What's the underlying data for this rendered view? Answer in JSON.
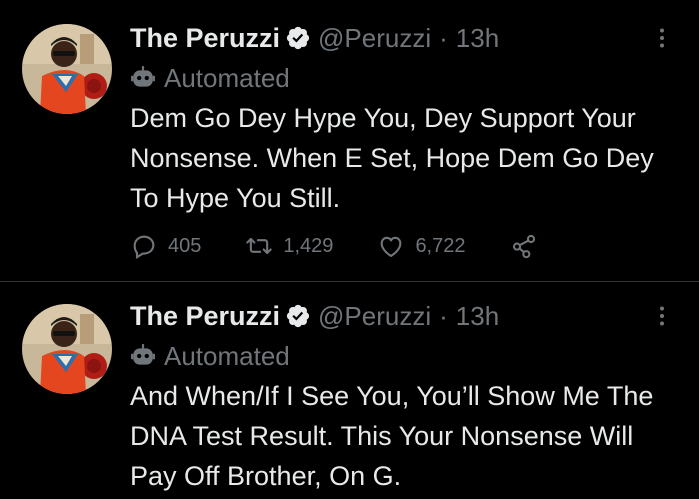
{
  "tweets": [
    {
      "display_name": "The Peruzzi",
      "handle": "@Peruzzi",
      "separator": "·",
      "time": "13h",
      "automated_label": "Automated",
      "text": "Dem Go Dey Hype You, Dey Support Your Nonsense. When E Set, Hope Dem Go Dey To Hype You Still.",
      "reply_count": "405",
      "retweet_count": "1,429",
      "like_count": "6,722"
    },
    {
      "display_name": "The Peruzzi",
      "handle": "@Peruzzi",
      "separator": "·",
      "time": "13h",
      "automated_label": "Automated",
      "text": "And When/If I See You, You’ll Show Me The DNA Test Result. This Your Nonsense Will Pay Off Brother, On G."
    }
  ],
  "icons": {
    "verified": "verified-badge-icon",
    "bot": "bot-icon",
    "more": "more-options-icon",
    "reply": "reply-icon",
    "retweet": "retweet-icon",
    "like": "heart-icon",
    "share": "share-icon"
  },
  "colors": {
    "background": "#000000",
    "text_primary": "#e7e9ea",
    "text_secondary": "#71767b",
    "divider": "#2f3336"
  }
}
